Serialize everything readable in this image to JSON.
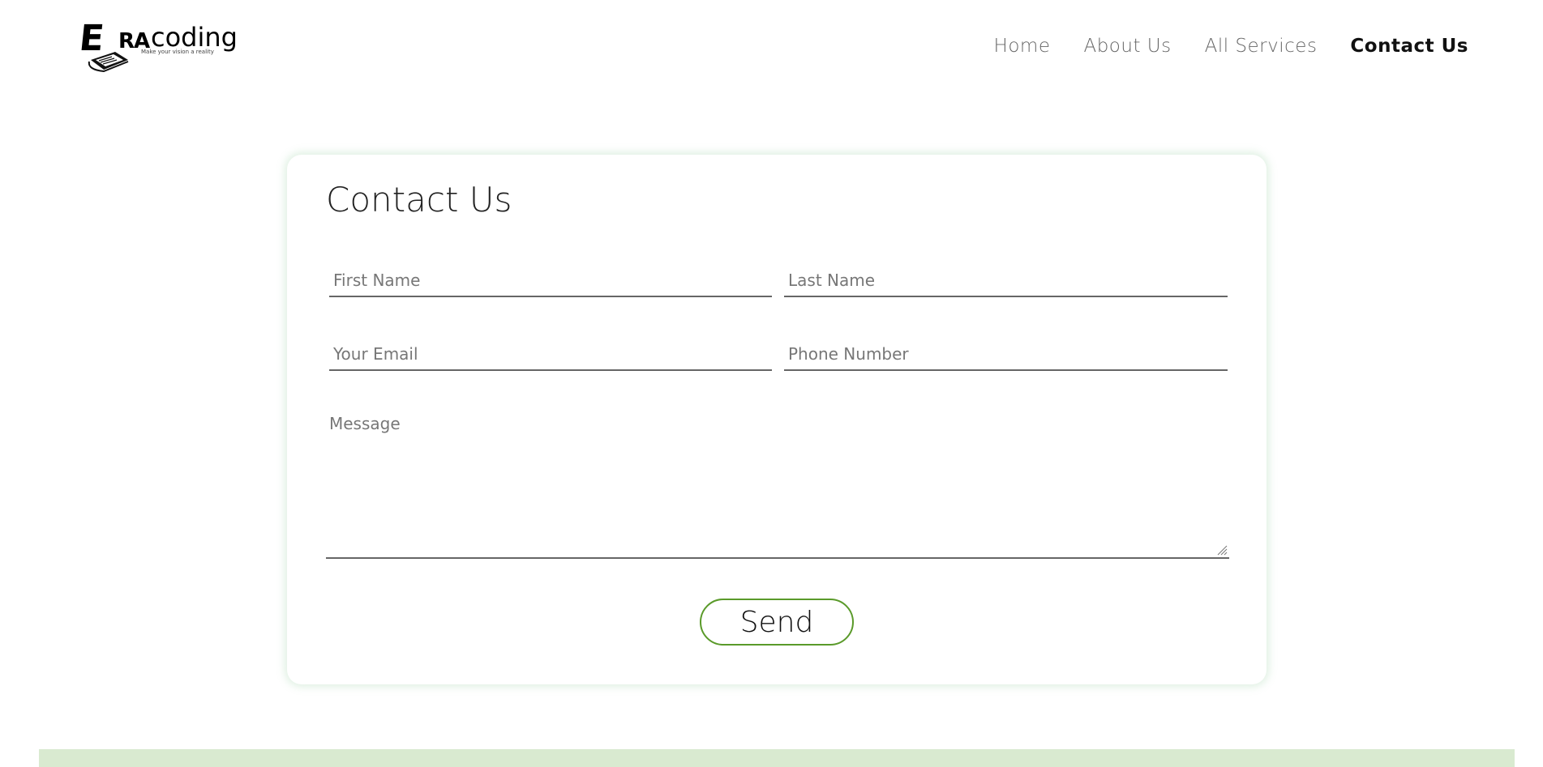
{
  "brand": {
    "logo_letter": "E",
    "logo_ra": "RA",
    "logo_coding": "coding",
    "tagline": "Make your vision a reality"
  },
  "nav": {
    "items": [
      {
        "label": "Home"
      },
      {
        "label": "About Us"
      },
      {
        "label": "All Services"
      },
      {
        "label": "Contact Us"
      }
    ],
    "active": "Contact Us"
  },
  "form": {
    "title": "Contact Us",
    "first_name_placeholder": "First Name",
    "last_name_placeholder": "Last Name",
    "email_placeholder": "Your Email",
    "phone_placeholder": "Phone Number",
    "message_placeholder": "Message",
    "send_label": "Send"
  },
  "colors": {
    "accent_green": "#5a9a2a",
    "footer_bar": "#d9ead0"
  }
}
